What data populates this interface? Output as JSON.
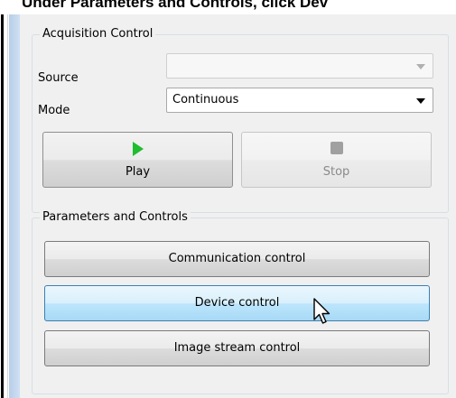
{
  "caption": {
    "text": "Under Parameters and Controls, click Dev"
  },
  "acquisition": {
    "title": "Acquisition Control",
    "source_label": "Source",
    "source_value": "",
    "mode_label": "Mode",
    "mode_value": "Continuous",
    "play_label": "Play",
    "stop_label": "Stop"
  },
  "parameters": {
    "title": "Parameters and Controls",
    "buttons": [
      {
        "label": "Communication control"
      },
      {
        "label": "Device control"
      },
      {
        "label": "Image stream control"
      }
    ]
  },
  "colors": {
    "play_icon": "#1fbd2f",
    "stop_icon": "#a0a0a0",
    "hover_button": "#bee6fd",
    "side_strip": "#b8cde8"
  },
  "icons": [
    "play-icon",
    "stop-icon",
    "mouse-cursor-icon",
    "dropdown-arrow-icon"
  ]
}
